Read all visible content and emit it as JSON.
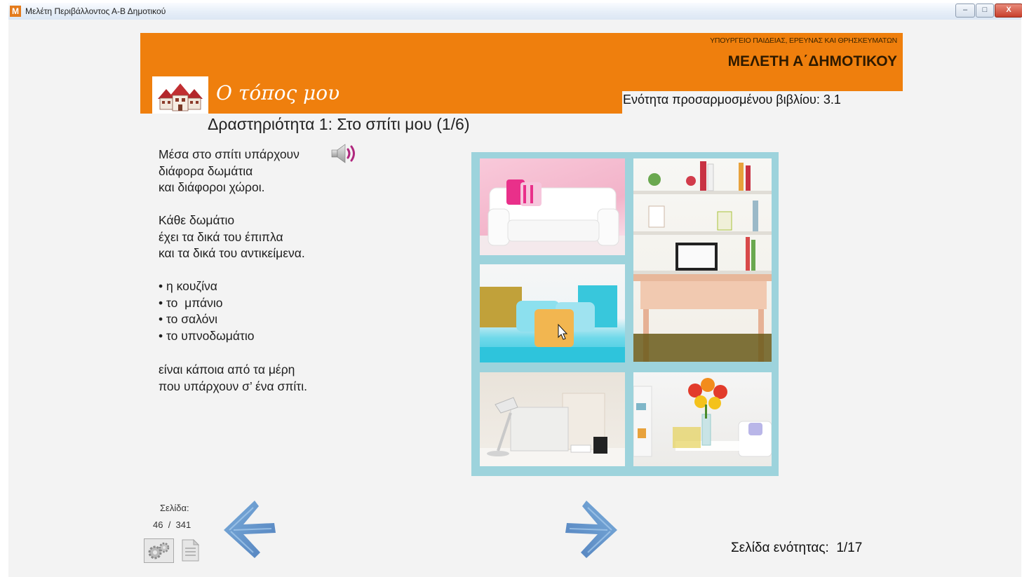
{
  "window": {
    "title": "Μελέτη Περιβάλλοντος Α-Β Δημοτικού",
    "app_icon_letter": "M",
    "controls": {
      "minimize": "–",
      "maximize": "□",
      "close": "X"
    }
  },
  "header": {
    "ministry": "ΥΠΟΥΡΓΕΙΟ ΠΑΙΔΕΙΑΣ, ΕΡΕΥΝΑΣ ΚΑΙ ΘΡΗΣΚΕΥΜΑΤΩΝ",
    "grade_title": "ΜΕΛΕΤΗ Α΄ΔΗΜΟΤΙΚΟΥ",
    "section_title": "Ο τόπος μου",
    "unit_label": "Ενότητα προσαρμοσμένου βιβλίου: 3.1",
    "accent_color": "#ef7f0d"
  },
  "activity": {
    "title": "Δραστηριότητα 1: Στο σπίτι μου (1/6)",
    "paragraph1": [
      "Μέσα στο σπίτι υπάρχουν",
      "διάφορα δωμάτια",
      "και διάφοροι χώροι."
    ],
    "paragraph2": [
      "Κάθε δωμάτιο",
      "έχει τα δικά του έπιπλα",
      "και τα δικά του αντικείμενα."
    ],
    "list": [
      "• η κουζίνα",
      "• το  μπάνιο",
      "• το σαλόνι",
      "• το υπνοδωμάτιο"
    ],
    "paragraph3": [
      "είναι κάποια από τα μέρη",
      "που υπάρχουν σ’ ένα σπίτι."
    ]
  },
  "footer": {
    "page_label": "Σελίδα:",
    "page_current": "46",
    "page_separator": "  /  ",
    "page_total": "341",
    "unit_page": "Σελίδα ενότητας:  1/17"
  },
  "icons": {
    "speaker": "speaker-icon",
    "prev": "left-arrow-icon",
    "next": "right-arrow-icon",
    "settings": "gears-icon",
    "document": "document-icon"
  }
}
